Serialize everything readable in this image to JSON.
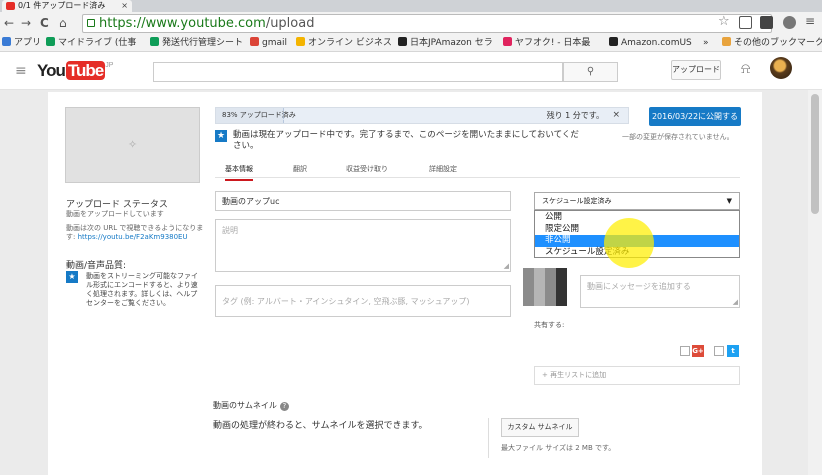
{
  "browser": {
    "tab_title": "0/1 件アップロード済み",
    "tab_close": "×",
    "nav": {
      "back": "←",
      "forward": "→",
      "reload": "C",
      "home": "⌂"
    },
    "url_host": "https://www.youtube.com",
    "url_path": "/upload",
    "bookmarks": [
      {
        "label": "アプリ",
        "color": "#3a7bd5"
      },
      {
        "label": "マイドライブ (仕事",
        "color": "#0f9d58"
      },
      {
        "label": "発送代行管理シート",
        "color": "#0f9d58"
      },
      {
        "label": "gmail",
        "color": "#db4437"
      },
      {
        "label": "オンライン ビジネス",
        "color": "#f4b400"
      },
      {
        "label": "日本JPAmazon セラ",
        "color": "#222222"
      },
      {
        "label": "ヤフオク! - 日本最",
        "color": "#e0245e"
      },
      {
        "label": "Amazon.comUS",
        "color": "#222222"
      },
      {
        "label": "»",
        "color": ""
      },
      {
        "label": "その他のブックマーク",
        "color": "#e8a33d"
      }
    ]
  },
  "header": {
    "menu_icon": "≡",
    "logo_you": "You",
    "logo_tube": "Tube",
    "logo_region": "JP",
    "search_icon": "⚲",
    "upload_label": "アップロード",
    "bell_icon": "⍾"
  },
  "upload": {
    "progress_text": "83% アップロード済み",
    "progress_percent": 83,
    "time_remaining": "残り 1 分です。",
    "close": "×",
    "publish_button": "2016/03/22に公開する",
    "info_icon": "★",
    "info_text": "動画は現在アップロード中です。完了するまで、このページを開いたままにしておいてください。",
    "saved_text": "一部の変更が保存されていません。",
    "tabs": [
      "基本情報",
      "翻訳",
      "収益受け取り",
      "詳細設定"
    ]
  },
  "sidebar": {
    "status_heading": "アップロード ステータス",
    "status_text": "動画をアップロードしています",
    "url_text": "動画は次の URL で視聴できるようになります:",
    "url": "https://youtu.be/F2aKm9380EU",
    "quality_heading": "動画/音声品質:",
    "quality_icon": "★",
    "quality_text": "動画をストリーミング可能なファイル形式にエンコードすると、より速く処理されます。詳しくは、ヘルプセンターをご覧ください。"
  },
  "form": {
    "title_value": "動画のアップuc",
    "description_placeholder": "説明",
    "tags_placeholder": "タグ (例: アルバート・アインシュタイン, 空飛ぶ豚, マッシュアップ)",
    "privacy_selected": "スケジュール設定済み",
    "privacy_options": [
      "公開",
      "限定公開",
      "非公開",
      "スケジュール設定済み"
    ],
    "privacy_highlighted_index": 2,
    "message_placeholder": "動画にメッセージを追加する",
    "share_label": "共有する:",
    "playlist_label": "+ 再生リストに追加",
    "social": [
      {
        "label": "G+",
        "color": "#dd4b39"
      },
      {
        "label": "t",
        "color": "#1da1f2"
      }
    ]
  },
  "thumbnail": {
    "heading": "動画のサムネイル",
    "help_icon": "?",
    "processing_text": "動画の処理が終わると、サムネイルを選択できます。",
    "custom_button": "カスタム サムネイル",
    "max_size": "最大ファイル サイズは 2 MB です。"
  }
}
